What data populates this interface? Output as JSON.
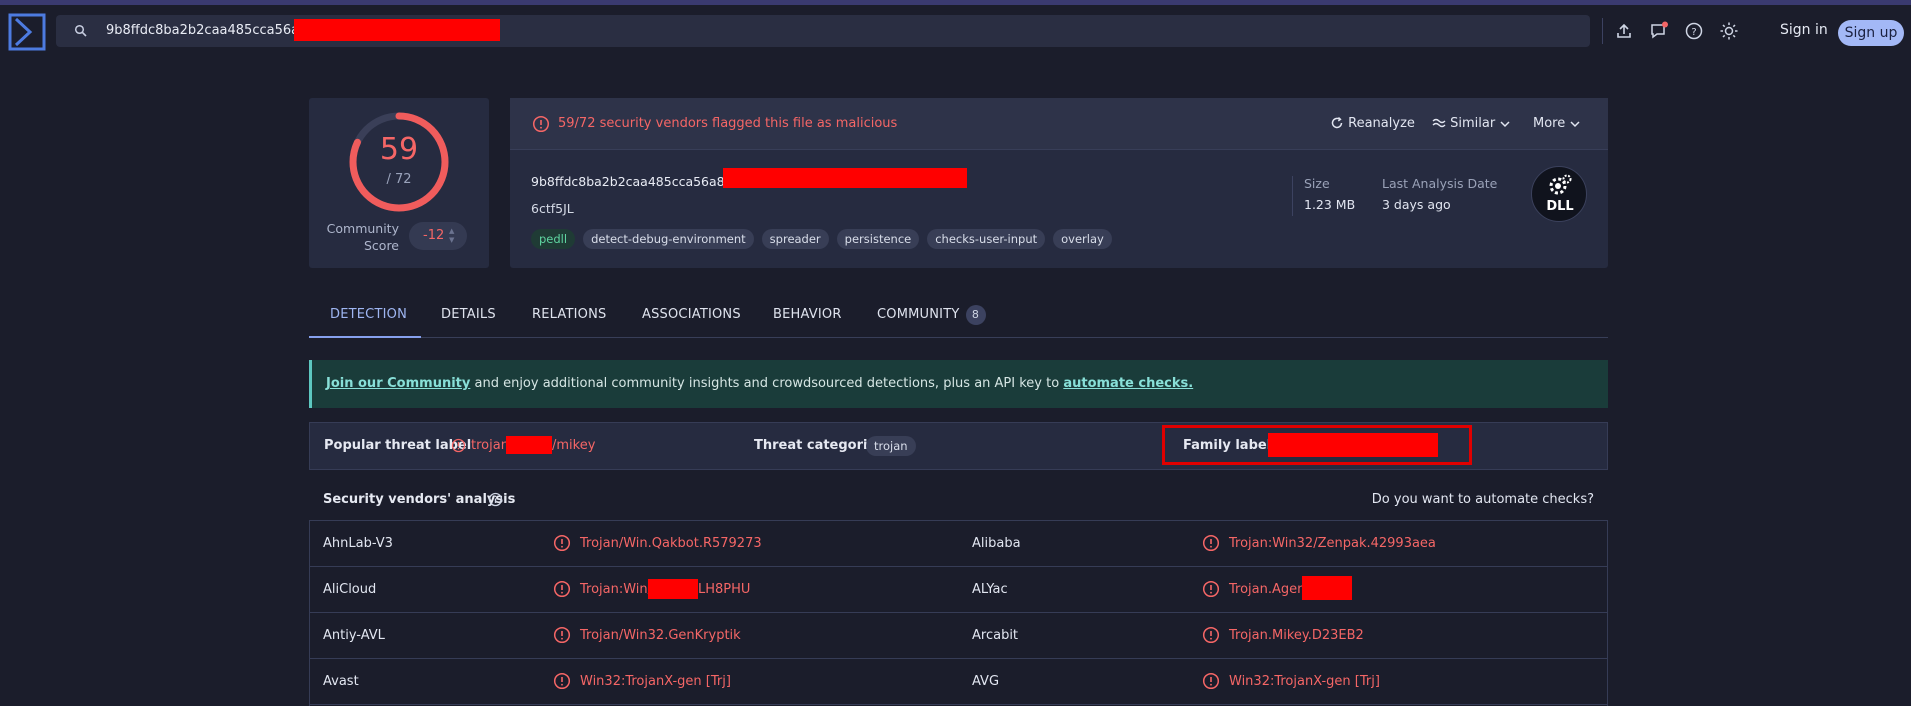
{
  "header": {
    "search_value": "9b8ffdc8ba2b2caa485cca56a82b",
    "sign_in": "Sign in",
    "sign_up": "Sign up",
    "icons": [
      "upload-icon",
      "chat-icon",
      "help-icon",
      "theme-icon"
    ]
  },
  "score": {
    "detections": "59",
    "total": "/ 72",
    "detection_ratio": 0.8194,
    "community_label": "Community Score",
    "community_value": "-12"
  },
  "summary": {
    "flag_text": "59/72 security vendors flagged this file as malicious",
    "reanalyze": "Reanalyze",
    "similar": "Similar",
    "more": "More",
    "hash": "9b8ffdc8ba2b2caa485cca56a82b",
    "filename": "6ctf5JL",
    "tags": [
      "pedll",
      "detect-debug-environment",
      "spreader",
      "persistence",
      "checks-user-input",
      "overlay"
    ],
    "size_label": "Size",
    "size_value": "1.23 MB",
    "date_label": "Last Analysis Date",
    "date_value": "3 days ago",
    "file_type": "DLL"
  },
  "tabs": [
    {
      "label": "DETECTION"
    },
    {
      "label": "DETAILS"
    },
    {
      "label": "RELATIONS"
    },
    {
      "label": "ASSOCIATIONS"
    },
    {
      "label": "BEHAVIOR"
    },
    {
      "label": "COMMUNITY",
      "badge": "8"
    }
  ],
  "banner": {
    "link1": "Join our Community",
    "middle": " and enjoy additional community insights and crowdsourced detections, plus an API key to ",
    "link2": "automate checks."
  },
  "threat": {
    "popular_label": "Popular threat label",
    "popular_prefix": "trojan",
    "popular_suffix": "/mikey",
    "categories_label": "Threat categories",
    "category": "trojan",
    "family_label": "Family labels"
  },
  "vendors": {
    "title": "Security vendors' analysis",
    "automate": "Do you want to automate checks?",
    "rows": [
      {
        "left_name": "AhnLab-V3",
        "left_result": "Trojan/Win.Qakbot.R579273",
        "right_name": "Alibaba",
        "right_result": "Trojan:Win32/Zenpak.42993aea"
      },
      {
        "left_name": "AliCloud",
        "left_result_a": "Trojan:Win/",
        "left_result_b": "LH8PHU",
        "right_name": "ALYac",
        "right_result": "Trojan.Agent"
      },
      {
        "left_name": "Antiy-AVL",
        "left_result": "Trojan/Win32.GenKryptik",
        "right_name": "Arcabit",
        "right_result": "Trojan.Mikey.D23EB2"
      },
      {
        "left_name": "Avast",
        "left_result": "Win32:TrojanX-gen [Trj]",
        "right_name": "AVG",
        "right_result": "Win32:TrojanX-gen [Trj]"
      }
    ]
  },
  "colors": {
    "accent": "#9fb6f2",
    "malicious": "#f56666",
    "background": "#1b1d2b",
    "card": "#262b40"
  }
}
